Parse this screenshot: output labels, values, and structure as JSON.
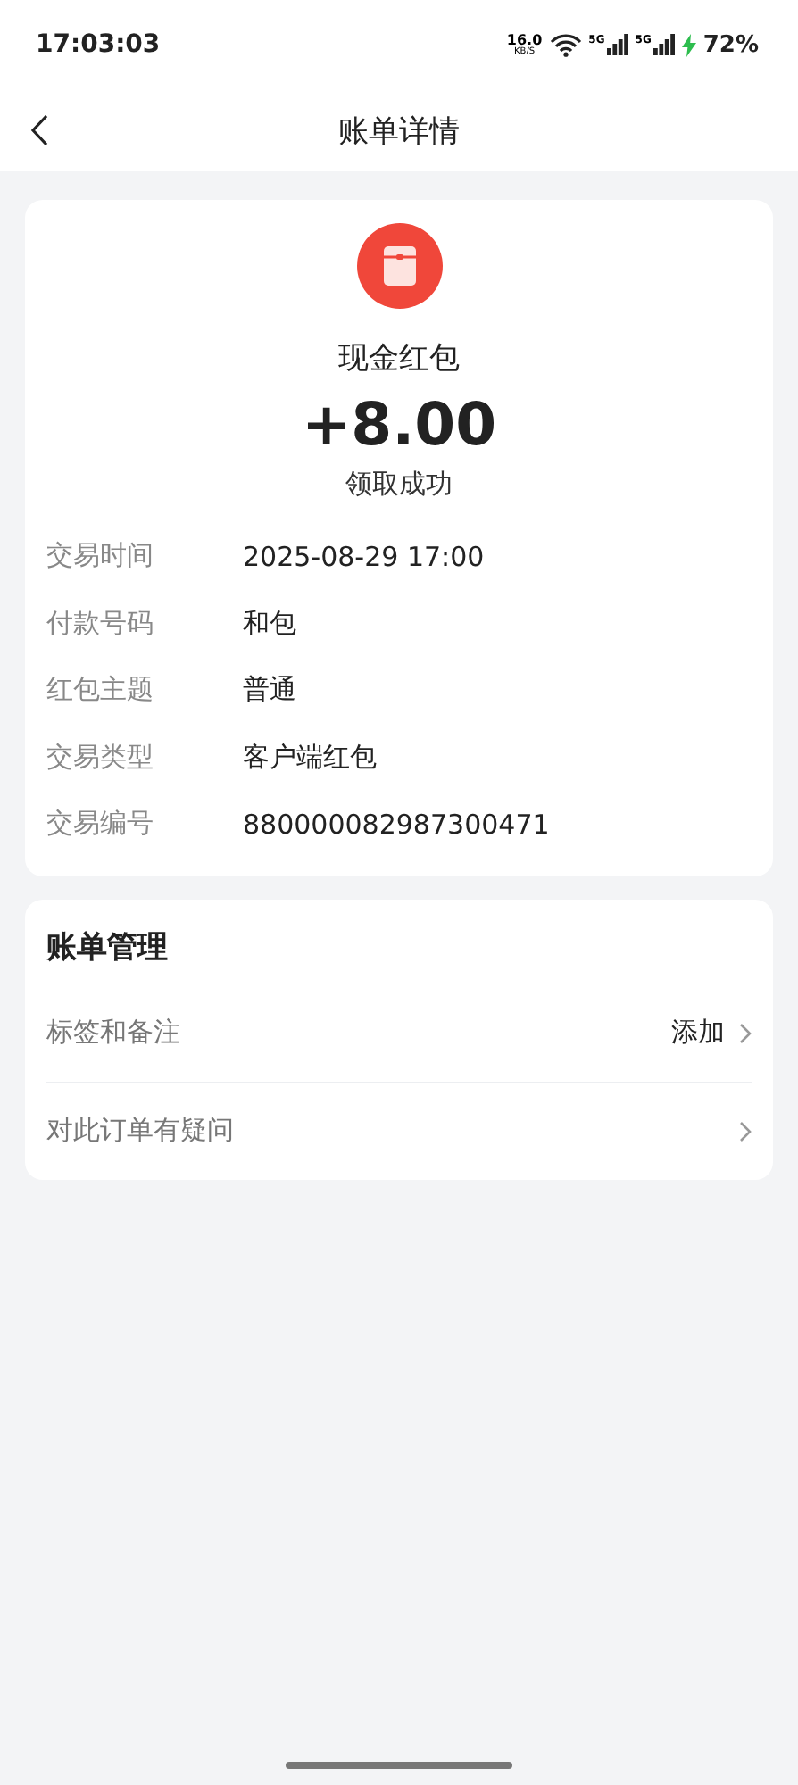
{
  "status_bar": {
    "time": "17:03:03",
    "net_speed": "16.0",
    "net_unit": "KB/S",
    "signals": [
      "5G",
      "5G"
    ],
    "battery": "72%",
    "charging": true
  },
  "nav": {
    "title": "账单详情"
  },
  "summary": {
    "name": "现金红包",
    "amount": "+8.00",
    "status": "领取成功"
  },
  "details": [
    {
      "label": "交易时间",
      "value": "2025-08-29 17:00"
    },
    {
      "label": "付款号码",
      "value": "和包"
    },
    {
      "label": "红包主题",
      "value": "普通"
    },
    {
      "label": "交易类型",
      "value": "客户端红包"
    },
    {
      "label": "交易编号",
      "value": "880000082987300471"
    }
  ],
  "management": {
    "title": "账单管理",
    "items": [
      {
        "label": "标签和备注",
        "value": "添加"
      },
      {
        "label": "对此订单有疑问"
      }
    ]
  }
}
